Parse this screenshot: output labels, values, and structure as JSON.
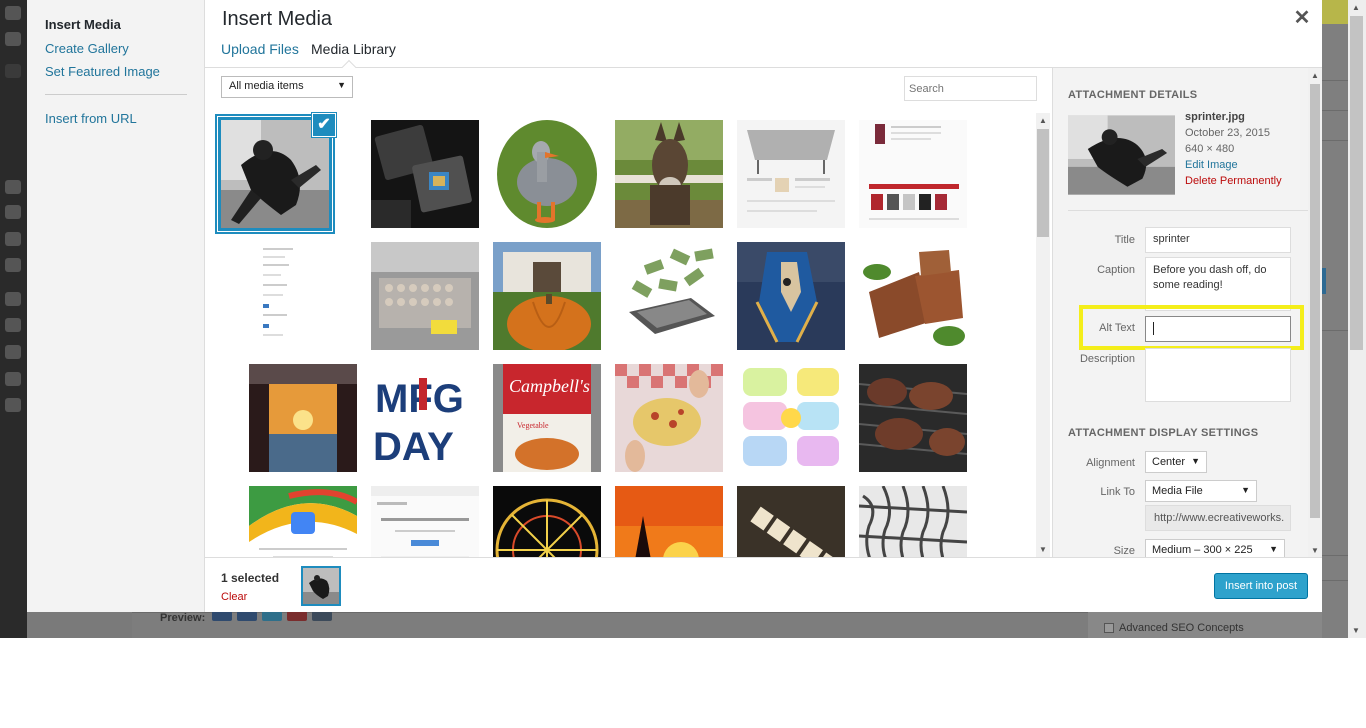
{
  "modal": {
    "menu": {
      "insert_media": "Insert Media",
      "create_gallery": "Create Gallery",
      "set_featured": "Set Featured Image",
      "insert_url": "Insert from URL"
    },
    "title": "Insert Media",
    "close_glyph": "✕",
    "tabs": {
      "upload": "Upload Files",
      "library": "Media Library"
    },
    "filter": {
      "selected": "All media items",
      "caret": "▼"
    },
    "search": {
      "placeholder": "Search",
      "value": ""
    },
    "check_glyph": "✔"
  },
  "grid": {
    "items": [
      {
        "name": "sprinter",
        "selected": true
      },
      {
        "name": "microchips"
      },
      {
        "name": "goose"
      },
      {
        "name": "donkey"
      },
      {
        "name": "furniture-website"
      },
      {
        "name": "clothing-website"
      },
      {
        "name": "document-page"
      },
      {
        "name": "factory-trays"
      },
      {
        "name": "pumpkin"
      },
      {
        "name": "laptop-money"
      },
      {
        "name": "armored-horse"
      },
      {
        "name": "meatloaf"
      },
      {
        "name": "pier-sunset"
      },
      {
        "name": "mfg-day"
      },
      {
        "name": "campbells-soup"
      },
      {
        "name": "pizza-hands"
      },
      {
        "name": "writing-process"
      },
      {
        "name": "grill-meat"
      },
      {
        "name": "google-business"
      },
      {
        "name": "google-page"
      },
      {
        "name": "ferris-wheel"
      },
      {
        "name": "sunset-sailboat"
      },
      {
        "name": "scrabble-tiles"
      },
      {
        "name": "abstract-grid"
      }
    ]
  },
  "details": {
    "heading": "Attachment Details",
    "filename": "sprinter.jpg",
    "date": "October 23, 2015",
    "dimensions": "640 × 480",
    "edit_link": "Edit Image",
    "delete_link": "Delete Permanently",
    "labels": {
      "title": "Title",
      "caption": "Caption",
      "alt": "Alt Text",
      "description": "Description"
    },
    "values": {
      "title": "sprinter",
      "caption": "Before you dash off, do some reading!",
      "alt": "",
      "description": ""
    }
  },
  "display": {
    "heading": "Attachment Display Settings",
    "alignment_label": "Alignment",
    "alignment_value": "Center",
    "link_label": "Link To",
    "link_value": "Media File",
    "link_url": "http://www.ecreativeworks.",
    "size_label": "Size",
    "size_value": "Medium – 300 × 225",
    "caret": "▼"
  },
  "footer": {
    "selected_count": "1 selected",
    "clear": "Clear",
    "insert_button": "Insert into post"
  },
  "background": {
    "preview_label": "Preview:",
    "seo_label": "Advanced SEO Concepts"
  },
  "colors": {
    "accent": "#1e8cbe",
    "link": "#21759b",
    "danger": "#bc0b0b",
    "highlight": "#f4ee1a",
    "primary_button": "#2ea2cc"
  }
}
